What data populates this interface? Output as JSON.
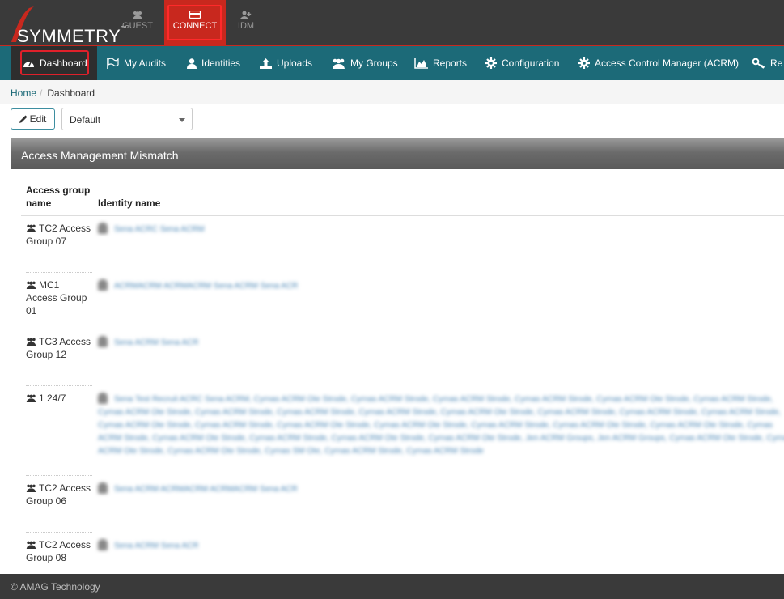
{
  "brand": {
    "name": "SYMMETRY",
    "tm": "™"
  },
  "app_tabs": [
    {
      "label": "GUEST"
    },
    {
      "label": "CONNECT"
    },
    {
      "label": "IDM"
    }
  ],
  "nav": [
    {
      "label": "Dashboard",
      "icon": "dashboard-icon"
    },
    {
      "label": "My Audits",
      "icon": "flag-icon"
    },
    {
      "label": "Identities",
      "icon": "user-icon"
    },
    {
      "label": "Uploads",
      "icon": "upload-icon"
    },
    {
      "label": "My Groups",
      "icon": "group-icon"
    },
    {
      "label": "Reports",
      "icon": "area-chart-icon"
    },
    {
      "label": "Configuration",
      "icon": "gear-icon"
    },
    {
      "label": "Access Control Manager (ACRM)",
      "icon": "gear-icon"
    },
    {
      "label": "Re",
      "icon": "key-icon"
    }
  ],
  "breadcrumb": {
    "home": "Home",
    "sep": "/",
    "current": "Dashboard"
  },
  "toolbar": {
    "edit_label": "Edit",
    "layout_selected": "Default"
  },
  "panel": {
    "title": "Access Management Mismatch",
    "columns": [
      "Access group name",
      "Identity name"
    ],
    "rows": [
      {
        "group": "TC2 Access Group 07",
        "identities": "Sena ACRC Sena ACRM"
      },
      {
        "group": "MC1 Access Group 01",
        "identities": "ACRMACRM ACRMACRM Sena ACRM Sena ACR"
      },
      {
        "group": "TC3 Access Group 12",
        "identities": "Sena ACRM Sena ACR"
      },
      {
        "group": "1 24/7",
        "identities": "Sena Test Recruit ACRC Sena ACRM, Cyrnas ACRM Ote Strode, Cyrnas ACRM Strode, Cyrnas ACRM Strode, Cyrnas ACRM Strode, Cyrnas ACRM Ote Strode, Cyrnas ACRM Strode, Cyrnas ACRM Ote Strode, Cyrnas ACRM Strode, Cyrnas ACRM Strode, Cyrnas ACRM Strode, Cyrnas ACRM Ote Strode, Cyrnas ACRM Strode, Cyrnas ACRM Strode, Cyrnas ACRM Strode, Cyrnas ACRM Ote Strode, Cyrnas ACRM Strode, Cyrnas ACRM Ote Strode, Cyrnas ACRM Ote Strode, Cyrnas ACRM Strode, Cyrnas ACRM Ote Strode, Cyrnas ACRM Ote Strode, Cyrnas ACRM Strode, Cyrnas ACRM Ote Strode, Cyrnas ACRM Strode, Cyrnas ACRM Ote Strode, Cyrnas ACRM Ote Strode, Jen ACRM Groups, Jen ACRM Groups, Cyrnas ACRM Ote Strode, Cyrnas ACRM Ote Strode, Cyrnas ACRM Ote Strode, Cyrnas SM Ote, Cyrnas ACRM Strode, Cyrnas ACRM Strode"
      },
      {
        "group": "TC2 Access Group 06",
        "identities": "Sena ACRM ACRMACRM ACRMACRM Sena ACR"
      },
      {
        "group": "TC2 Access Group 08",
        "identities": "Sena ACRM Sena ACR"
      }
    ]
  },
  "footer": {
    "text": "© AMAG Technology"
  },
  "colors": {
    "topbar": "#3a3a3a",
    "accent_red": "#c8281e",
    "nav_teal": "#1c6a78",
    "active_nav": "#2e2e2e"
  }
}
